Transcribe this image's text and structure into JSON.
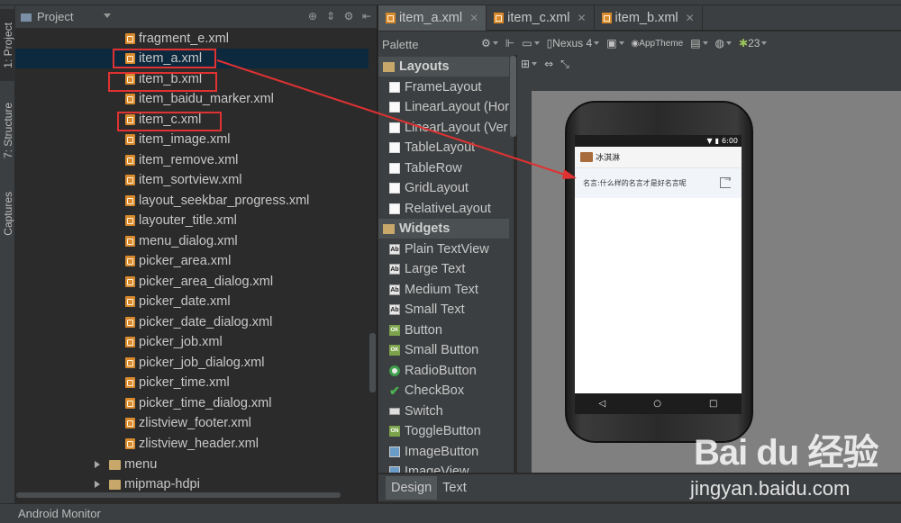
{
  "project_panel": {
    "title": "Project",
    "header_icons": [
      "target-icon",
      "collapse-icon",
      "gear-icon",
      "hide-icon"
    ],
    "files": [
      "fragment_e.xml",
      "item_a.xml",
      "item_b.xml",
      "item_baidu_marker.xml",
      "item_c.xml",
      "item_image.xml",
      "item_remove.xml",
      "item_sortview.xml",
      "layout_seekbar_progress.xml",
      "layouter_title.xml",
      "menu_dialog.xml",
      "picker_area.xml",
      "picker_area_dialog.xml",
      "picker_date.xml",
      "picker_date_dialog.xml",
      "picker_job.xml",
      "picker_job_dialog.xml",
      "picker_time.xml",
      "picker_time_dialog.xml",
      "zlistview_footer.xml",
      "zlistview_header.xml"
    ],
    "folders": [
      "menu",
      "mipmap-hdpi"
    ],
    "selected_file": "item_a.xml"
  },
  "left_strip": {
    "tabs": [
      "1: Project",
      "7: Structure",
      "Captures"
    ]
  },
  "editor_tabs": [
    {
      "label": "item_a.xml",
      "active": true
    },
    {
      "label": "item_c.xml",
      "active": false
    },
    {
      "label": "item_b.xml",
      "active": false
    }
  ],
  "palette": {
    "title": "Palette",
    "layouts_label": "Layouts",
    "layouts": [
      "FrameLayout",
      "LinearLayout (Hor",
      "LinearLayout (Ver",
      "TableLayout",
      "TableRow",
      "GridLayout",
      "RelativeLayout"
    ],
    "widgets_label": "Widgets",
    "widgets": [
      "Plain TextView",
      "Large Text",
      "Medium Text",
      "Small Text",
      "Button",
      "Small Button",
      "RadioButton",
      "CheckBox",
      "Switch",
      "ToggleButton",
      "ImageButton",
      "ImageView"
    ]
  },
  "design_toolbar": {
    "device": "Nexus 4",
    "theme": "AppTheme",
    "api": "23"
  },
  "preview": {
    "status_time": "6:00",
    "app_title": "冰淇淋",
    "item_text": "名言:什么样的名言才是好名言呢",
    "nav_back": "◁",
    "nav_home": "○",
    "nav_recent": "□"
  },
  "bottom_tabs": [
    {
      "label": "Design",
      "active": true
    },
    {
      "label": "Text",
      "active": false
    }
  ],
  "status_bar": {
    "label": "Android Monitor"
  },
  "watermark": {
    "logo": "Bai du 经验",
    "url": "jingyan.baidu.com"
  },
  "colors": {
    "highlight_box": "#e03232",
    "selection": "#0d293e",
    "panel": "#3c3f41",
    "editor_bg": "#2b2b2b"
  }
}
